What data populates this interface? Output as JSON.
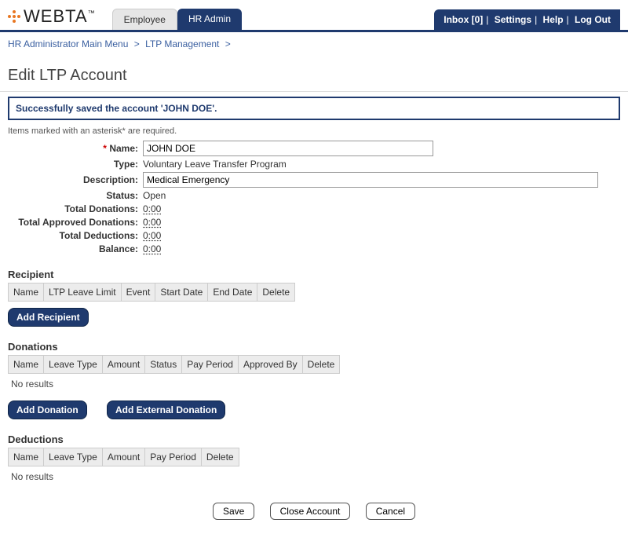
{
  "header": {
    "logo_text": "WEBTA",
    "tm": "™",
    "tabs": {
      "employee": "Employee",
      "hr_admin": "HR Admin"
    },
    "links": {
      "inbox": "Inbox [0]",
      "settings": "Settings",
      "help": "Help",
      "logout": "Log Out"
    }
  },
  "breadcrumb": {
    "item1": "HR Administrator Main Menu",
    "item2": "LTP Management",
    "sep": ">"
  },
  "page": {
    "title": "Edit LTP Account",
    "notice": "Successfully saved the account 'JOHN DOE'.",
    "required_note": "Items marked with an asterisk* are required."
  },
  "form": {
    "name": {
      "label": "Name:",
      "value": "JOHN DOE"
    },
    "type": {
      "label": "Type:",
      "value": "Voluntary Leave Transfer Program"
    },
    "description": {
      "label": "Description:",
      "value": "Medical Emergency"
    },
    "status": {
      "label": "Status:",
      "value": "Open"
    },
    "total_donations": {
      "label": "Total Donations:",
      "value": "0:00"
    },
    "total_approved": {
      "label": "Total Approved Donations:",
      "value": "0:00"
    },
    "total_deductions": {
      "label": "Total Deductions:",
      "value": "0:00"
    },
    "balance": {
      "label": "Balance:",
      "value": "0:00"
    }
  },
  "recipient": {
    "heading": "Recipient",
    "cols": {
      "c0": "Name",
      "c1": "LTP Leave Limit",
      "c2": "Event",
      "c3": "Start Date",
      "c4": "End Date",
      "c5": "Delete"
    },
    "add_button": "Add Recipient"
  },
  "donations": {
    "heading": "Donations",
    "cols": {
      "c0": "Name",
      "c1": "Leave Type",
      "c2": "Amount",
      "c3": "Status",
      "c4": "Pay Period",
      "c5": "Approved By",
      "c6": "Delete"
    },
    "no_results": "No results",
    "add_button": "Add Donation",
    "add_external_button": "Add External Donation"
  },
  "deductions": {
    "heading": "Deductions",
    "cols": {
      "c0": "Name",
      "c1": "Leave Type",
      "c2": "Amount",
      "c3": "Pay Period",
      "c4": "Delete"
    },
    "no_results": "No results"
  },
  "footer": {
    "save": "Save",
    "close_account": "Close Account",
    "cancel": "Cancel"
  }
}
